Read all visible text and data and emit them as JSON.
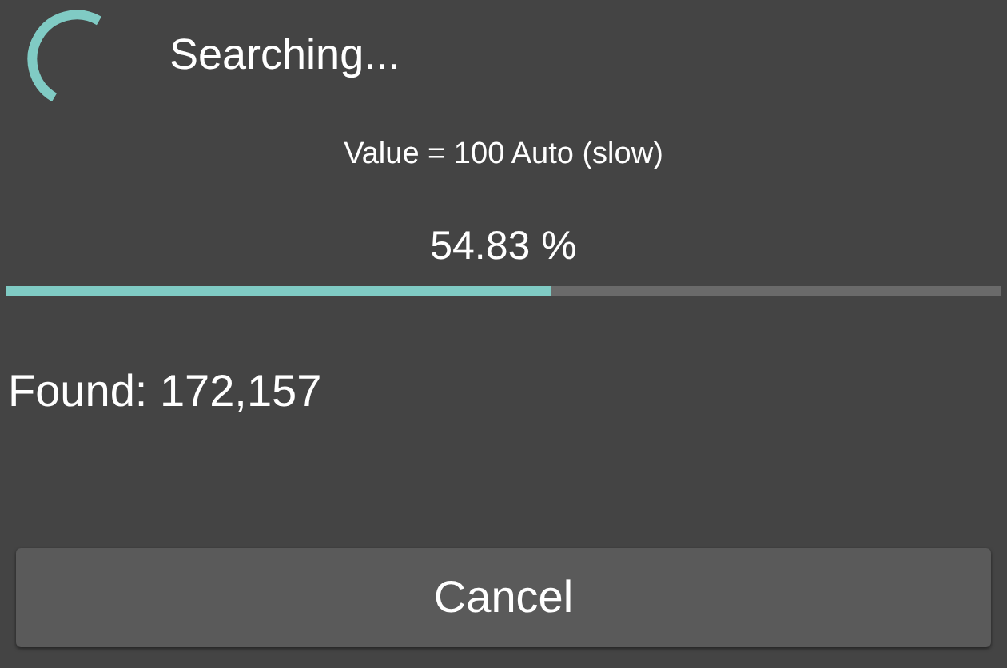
{
  "dialog": {
    "title": "Searching...",
    "value_line": "Value = 100 Auto (slow)",
    "progress": {
      "reading": "54.83 %",
      "level": 0.5483
    },
    "found": "Found: 172,157",
    "buttons": [
      "Cancel"
    ]
  }
}
